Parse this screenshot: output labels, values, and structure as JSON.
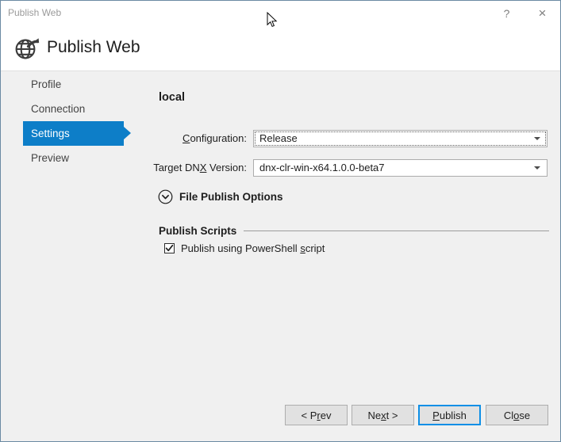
{
  "window": {
    "title": "Publish Web",
    "help_label": "?",
    "close_label": "×"
  },
  "header": {
    "title": "Publish Web",
    "icon": "globe-publish-icon"
  },
  "sidebar": {
    "items": [
      {
        "label": "Profile",
        "selected": false
      },
      {
        "label": "Connection",
        "selected": false
      },
      {
        "label": "Settings",
        "selected": true
      },
      {
        "label": "Preview",
        "selected": false
      }
    ]
  },
  "main": {
    "panel_title": "local",
    "fields": [
      {
        "label_pre": "",
        "label_accel": "C",
        "label_post": "onfiguration:",
        "value": "Release",
        "focused": true
      },
      {
        "label_pre": "Target DN",
        "label_accel": "X",
        "label_post": " Version:",
        "value": "dnx-clr-win-x64.1.0.0-beta7",
        "focused": false
      }
    ],
    "expander": {
      "label": "File Publish Options",
      "icon": "chevron-down-circle-icon",
      "expanded": false
    },
    "group": {
      "title": "Publish Scripts",
      "checkbox": {
        "text_pre": "Publish using PowerShell ",
        "text_accel": "s",
        "text_post": "cript",
        "checked": true
      }
    }
  },
  "footer": {
    "buttons": [
      {
        "pre": "< P",
        "accel": "r",
        "post": "ev",
        "name": "prev-button",
        "default": false
      },
      {
        "pre": "Ne",
        "accel": "x",
        "post": "t >",
        "name": "next-button",
        "default": false
      },
      {
        "pre": "",
        "accel": "P",
        "post": "ublish",
        "name": "publish-button",
        "default": true
      },
      {
        "pre": "Cl",
        "accel": "o",
        "post": "se",
        "name": "close-button",
        "default": false
      }
    ]
  },
  "colors": {
    "accent": "#0d7ec8",
    "focus_border": "#0d8fe6",
    "dialog_bg": "#f0f0f0",
    "header_bg": "#ffffff",
    "dialog_border": "#6b8aa3"
  }
}
